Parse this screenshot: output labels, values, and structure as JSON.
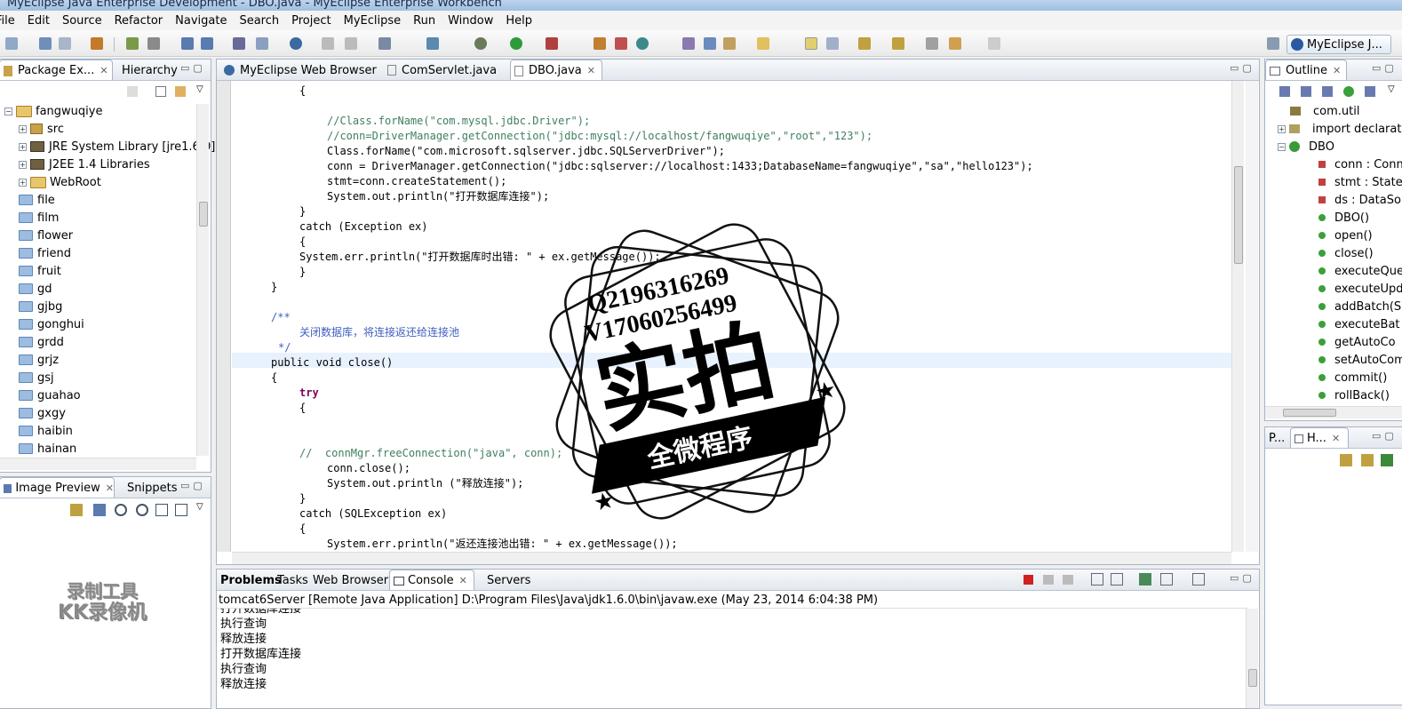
{
  "window": {
    "title": "MyEclipse Java Enterprise Development - DBO.java - MyEclipse Enterprise Workbench"
  },
  "menu": [
    "File",
    "Edit",
    "Source",
    "Refactor",
    "Navigate",
    "Search",
    "Project",
    "MyEclipse",
    "Run",
    "Window",
    "Help"
  ],
  "perspective": {
    "label": "MyEclipse J..."
  },
  "package_explorer": {
    "tabs": [
      "Package Ex...",
      "Hierarchy"
    ],
    "tree": [
      {
        "label": "fangwuqiye",
        "kind": "project"
      },
      {
        "label": "src",
        "kind": "package"
      },
      {
        "label": "JRE System Library [jre1.6.0]",
        "kind": "library"
      },
      {
        "label": "J2EE 1.4 Libraries",
        "kind": "library"
      },
      {
        "label": "WebRoot",
        "kind": "folder"
      },
      {
        "label": "file"
      },
      {
        "label": "film"
      },
      {
        "label": "flower"
      },
      {
        "label": "friend"
      },
      {
        "label": "fruit"
      },
      {
        "label": "gd"
      },
      {
        "label": "gjbg"
      },
      {
        "label": "gonghui"
      },
      {
        "label": "grdd"
      },
      {
        "label": "grjz"
      },
      {
        "label": "gsj"
      },
      {
        "label": "guahao"
      },
      {
        "label": "gxgy"
      },
      {
        "label": "haibin"
      },
      {
        "label": "hainan"
      }
    ]
  },
  "image_preview": {
    "tabs": [
      "Image Preview",
      "Snippets"
    ]
  },
  "editor": {
    "tabs": [
      "MyEclipse Web Browser",
      "ComServlet.java",
      "DBO.java"
    ],
    "lines": [
      "{",
      "",
      "//Class.forName(\"com.mysql.jdbc.Driver\");",
      "//conn=DriverManager.getConnection(\"jdbc:mysql://localhost/fangwuqiye\",\"root\",\"123\");",
      "Class.forName(\"com.microsoft.sqlserver.jdbc.SQLServerDriver\");",
      "conn = DriverManager.getConnection(\"jdbc:sqlserver://localhost:1433;DatabaseName=fangwuqiye\",\"sa\",\"hello123\");",
      "stmt=conn.createStatement();",
      "System.out.println(\"打开数据库连接\");",
      "}",
      "catch (Exception ex)",
      "{",
      "System.err.println(\"打开数据库时出错: \" + ex.getMessage());",
      "}",
      "}",
      "",
      "/**",
      "关闭数据库，将连接返还给连接池",
      "*/",
      "public void close()",
      "{",
      "try",
      "{",
      "",
      "",
      "//  connMgr.freeConnection(\"java\", conn);",
      "conn.close();",
      "System.out.println (\"释放连接\");",
      "}",
      "catch (SQLException ex)",
      "{",
      "System.err.println(\"返还连接池出错: \" + ex.getMessage());"
    ]
  },
  "outline": {
    "tab": "Outline",
    "items": [
      {
        "label": "com.util"
      },
      {
        "label": "import declarati"
      },
      {
        "label": "DBO"
      },
      {
        "label": "conn : Conn"
      },
      {
        "label": "stmt : State"
      },
      {
        "label": "ds : DataSo"
      },
      {
        "label": "DBO()"
      },
      {
        "label": "open()"
      },
      {
        "label": "close()"
      },
      {
        "label": "executeQue"
      },
      {
        "label": "executeUpd"
      },
      {
        "label": "addBatch(S"
      },
      {
        "label": "executeBat"
      },
      {
        "label": "getAutoCo"
      },
      {
        "label": "setAutoCom"
      },
      {
        "label": "commit()"
      },
      {
        "label": "rollBack()"
      }
    ]
  },
  "mini_view": {
    "tabs": [
      "P...",
      "H..."
    ]
  },
  "console": {
    "tabs": [
      "Problems",
      "Tasks",
      "Web Browser",
      "Console",
      "Servers"
    ],
    "header": "tomcat6Server [Remote Java Application] D:\\Program Files\\Java\\jdk1.6.0\\bin\\javaw.exe (May 23, 2014 6:04:38 PM)",
    "lines": [
      "打开数据库连接",
      "执行查询",
      "释放连接",
      "打开数据库连接",
      "执行查询",
      "释放连接"
    ]
  },
  "watermark": {
    "qq": "Q2196316269",
    "vx": "V17060256499",
    "big": "实拍",
    "banner": "全微程序",
    "recorder1": "录制工具",
    "recorder2": "KK录像机"
  }
}
